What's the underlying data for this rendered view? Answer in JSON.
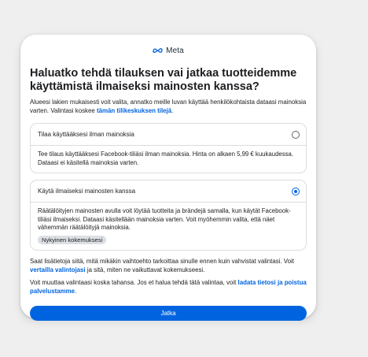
{
  "brand": {
    "logo_icon": "meta-infinity-icon",
    "name": "Meta",
    "accent": "#0064e0"
  },
  "title": "Haluatko tehdä tilauksen vai jatkaa tuotteidemme käyttämistä ilmaiseksi mainosten kanssa?",
  "intro": {
    "text": "Alueesi lakien mukaisesti voit valita, annatko meille luvan käyttää henkilökohtaista dataasi mainoksia varten. Valintasi koskee ",
    "link": "tämän tilikeskuksen tilejä",
    "end": "."
  },
  "options": [
    {
      "label": "Tilaa käyttääksesi ilman mainoksia",
      "selected": false,
      "description": "Tee tilaus käyttääksesi Facebook-tiliäsi ilman mainoksia. Hinta on alkaen 5,99 € kuukaudessa. Dataasi ei käsitellä mainoksia varten."
    },
    {
      "label": "Käytä ilmaiseksi mainosten kanssa",
      "selected": true,
      "description": "Räätälöityjen mainosten avulla voit löytää tuotteita ja brändejä samalla, kun käytät Facebook-tiliäsi ilmaiseksi. Dataasi käsitellään mainoksia varten. Voit myöhemmin valita, että näet vähemmän räätälöityjä mainoksia.",
      "badge": "Nykyinen kokemuksesi"
    }
  ],
  "info": {
    "text": "Saat lisätietoja siitä, mitä mikäkin vaihtoehto tarkoittaa sinulle ennen kuin vahvistat valintasi. Voit ",
    "link": "vertailla valintojasi",
    "end": " ja sitä, miten ne vaikuttavat kokemukseesi."
  },
  "change": {
    "text": "Voit muuttaa valintaasi koska tahansa. Jos et halua tehdä tätä valintaa, voit ",
    "link": "ladata tietosi ja poistua palvelustamme",
    "end": "."
  },
  "continue_button": "Jatka"
}
